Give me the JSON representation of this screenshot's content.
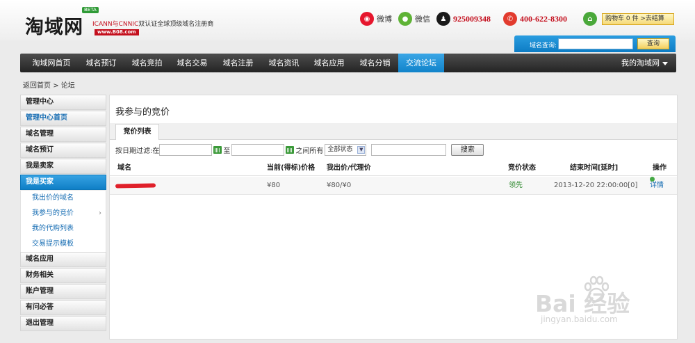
{
  "header": {
    "logo": "淘域网",
    "beta": "BETA",
    "tagline_prefix": "ICANN与CNNIC",
    "tagline_suffix": "双认证全球顶级域名注册商",
    "logo_url": "www.B08.com",
    "weibo_label": "微博",
    "wechat_label": "微信",
    "qq_number": "925009348",
    "phone": "400-622-8300",
    "cart": "购物车 0 件 >去结算"
  },
  "search": {
    "label": "域名查询:",
    "value": "",
    "button": "查询"
  },
  "nav": {
    "items": [
      "淘域网首页",
      "域名预订",
      "域名竞拍",
      "域名交易",
      "域名注册",
      "域名资讯",
      "域名应用",
      "域名分销",
      "交流论坛"
    ],
    "active_index": 8,
    "account": "我的淘域网"
  },
  "breadcrumb": {
    "home": "返回首页",
    "sep": ">",
    "current": "论坛"
  },
  "sidebar": {
    "header": "管理中心",
    "items": [
      {
        "label": "管理中心首页"
      },
      {
        "label": "域名管理"
      },
      {
        "label": "域名预订"
      },
      {
        "label": "我是卖家"
      },
      {
        "label": "我是买家"
      }
    ],
    "sub_items": [
      "我出价的域名",
      "我参与的竞价",
      "我的代购列表",
      "交易提示模板"
    ],
    "bottom_items": [
      "域名应用",
      "财务相关",
      "账户管理",
      "有问必答",
      "退出管理"
    ]
  },
  "main": {
    "title": "我参与的竞价",
    "tab": "竞价列表",
    "filter": {
      "label": "按日期过滤:在",
      "to": "至",
      "between": "之间所有",
      "status": "全部状态",
      "search_button": "搜索"
    },
    "columns": [
      "域名",
      "当前(得标)价格",
      "我出价/代理价",
      "竞价状态",
      "结束时间[延时]",
      "操作"
    ],
    "rows": [
      {
        "price": "¥80",
        "my_bid": "¥80/¥0",
        "status": "领先",
        "end_time": "2013-12-20 22:00:00[0]",
        "action": "详情"
      }
    ]
  },
  "watermark": {
    "text": "Bai 经验",
    "sub": "jingyan.baidu.com"
  }
}
